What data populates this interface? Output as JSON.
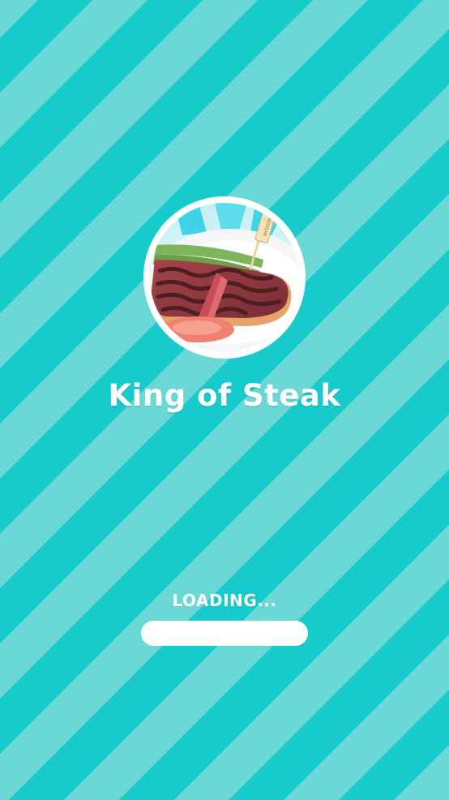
{
  "game": {
    "title": "King of Steak",
    "logo_icon": "steak-plate-icon",
    "flag_text": "MEDIUM"
  },
  "loading": {
    "label": "LOADING...",
    "progress": 0
  },
  "colors": {
    "stripe_light": "#6ad9d6",
    "stripe_dark": "#17cacc",
    "text": "#ffffff",
    "progress_track": "#ffffff"
  }
}
